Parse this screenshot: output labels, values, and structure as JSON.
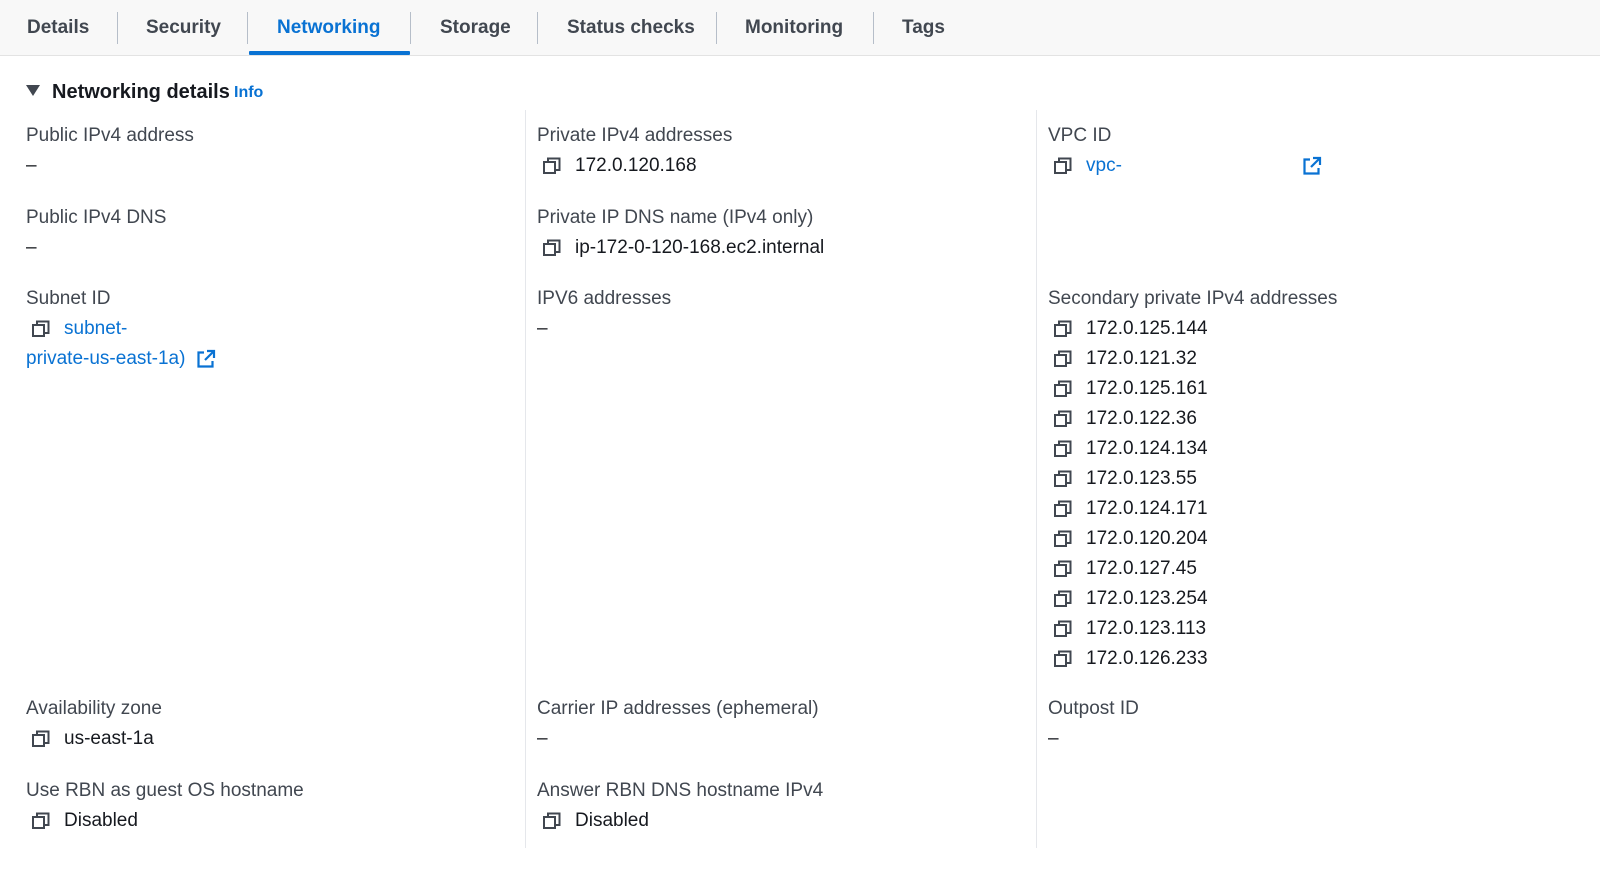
{
  "tabs": [
    "Details",
    "Security",
    "Networking",
    "Storage",
    "Status checks",
    "Monitoring",
    "Tags"
  ],
  "active_tab": "Networking",
  "panel": {
    "title": "Networking details",
    "info": "Info"
  },
  "fields": {
    "public_ipv4_address": {
      "label": "Public IPv4 address",
      "value": "–"
    },
    "private_ipv4_addresses": {
      "label": "Private IPv4 addresses",
      "value": "172.0.120.168"
    },
    "vpc_id": {
      "label": "VPC ID",
      "value": "vpc-"
    },
    "public_ipv4_dns": {
      "label": "Public IPv4 DNS",
      "value": "–"
    },
    "private_ip_dns_name": {
      "label": "Private IP DNS name (IPv4 only)",
      "value": "ip-172-0-120-168.ec2.internal"
    },
    "subnet_id": {
      "label": "Subnet ID",
      "value_line1": "subnet-",
      "value_line2": "private-us-east-1a)"
    },
    "ipv6_addresses": {
      "label": "IPV6 addresses",
      "value": "–"
    },
    "secondary_private_ipv4": {
      "label": "Secondary private IPv4 addresses",
      "values": [
        "172.0.125.144",
        "172.0.121.32",
        "172.0.125.161",
        "172.0.122.36",
        "172.0.124.134",
        "172.0.123.55",
        "172.0.124.171",
        "172.0.120.204",
        "172.0.127.45",
        "172.0.123.254",
        "172.0.123.113",
        "172.0.126.233"
      ]
    },
    "availability_zone": {
      "label": "Availability zone",
      "value": "us-east-1a"
    },
    "carrier_ip_addresses": {
      "label": "Carrier IP addresses (ephemeral)",
      "value": "–"
    },
    "outpost_id": {
      "label": "Outpost ID",
      "value": "–"
    },
    "use_rbn_hostname": {
      "label": "Use RBN as guest OS hostname",
      "value": "Disabled"
    },
    "answer_rbn_dns": {
      "label": "Answer RBN DNS hostname IPv4",
      "value": "Disabled"
    }
  },
  "colors": {
    "link": "#0972d3",
    "text": "#16191f",
    "label": "#414750",
    "tab_bar": "#f8f8f8"
  },
  "icons": {
    "copy": "copy-icon",
    "external": "external-link-icon",
    "caret": "caret-down-icon"
  }
}
